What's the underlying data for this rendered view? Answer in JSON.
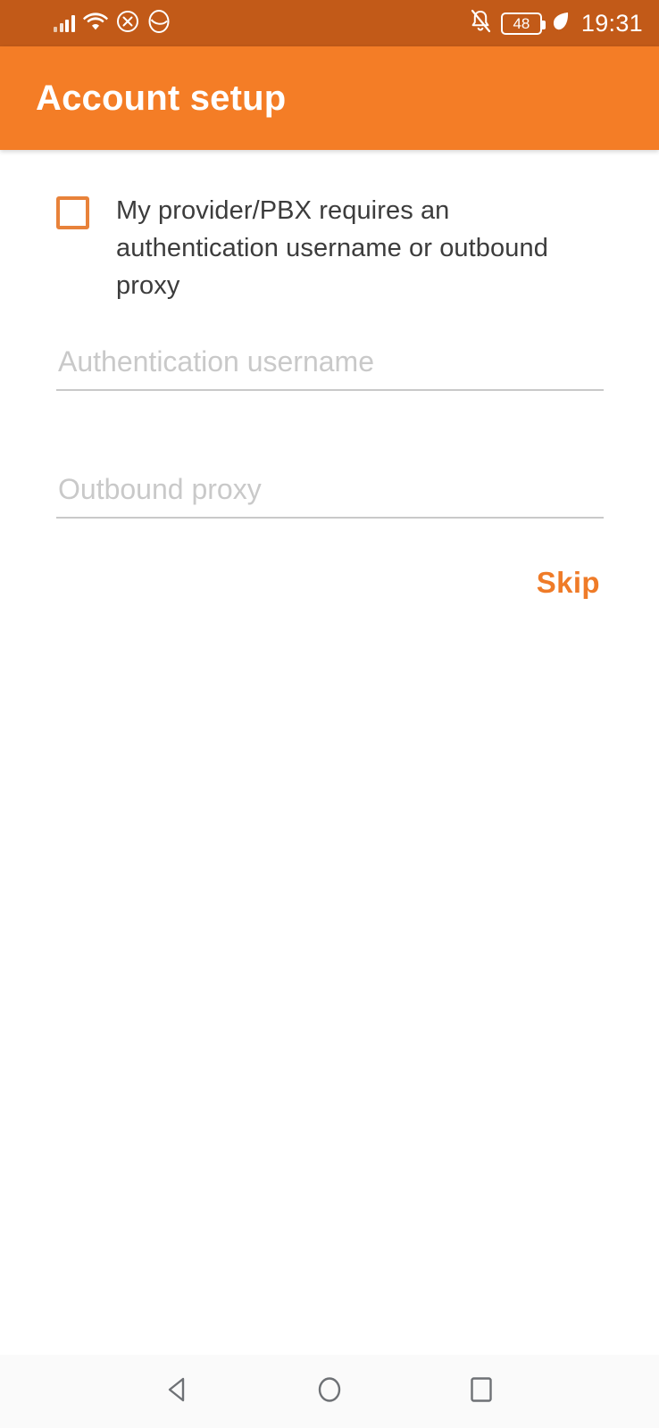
{
  "status_bar": {
    "background_color": "#C25A18",
    "icons_left": [
      "signal-bars-icon",
      "wifi-icon",
      "x-circle-icon",
      "app-circle-icon"
    ],
    "notification_mute_icon": "bell-slash-icon",
    "battery_level": "48",
    "power_saving_icon": "leaf-icon",
    "time": "19:31"
  },
  "app_bar": {
    "title": "Account setup",
    "background_color": "#F47D26",
    "title_color": "#FFFFFF"
  },
  "main": {
    "checkbox": {
      "label": "My provider/PBX requires an authentication username or outbound proxy",
      "checked": false,
      "border_color": "#E8823A"
    },
    "fields": [
      {
        "name": "authentication-username",
        "placeholder": "Authentication username",
        "value": ""
      },
      {
        "name": "outbound-proxy",
        "placeholder": "Outbound proxy",
        "value": ""
      }
    ],
    "skip_label": "Skip",
    "skip_color": "#EF7B28"
  },
  "nav_bar": {
    "background_color": "#FAFAFA",
    "buttons": [
      "back-icon",
      "home-icon",
      "recents-icon"
    ]
  }
}
